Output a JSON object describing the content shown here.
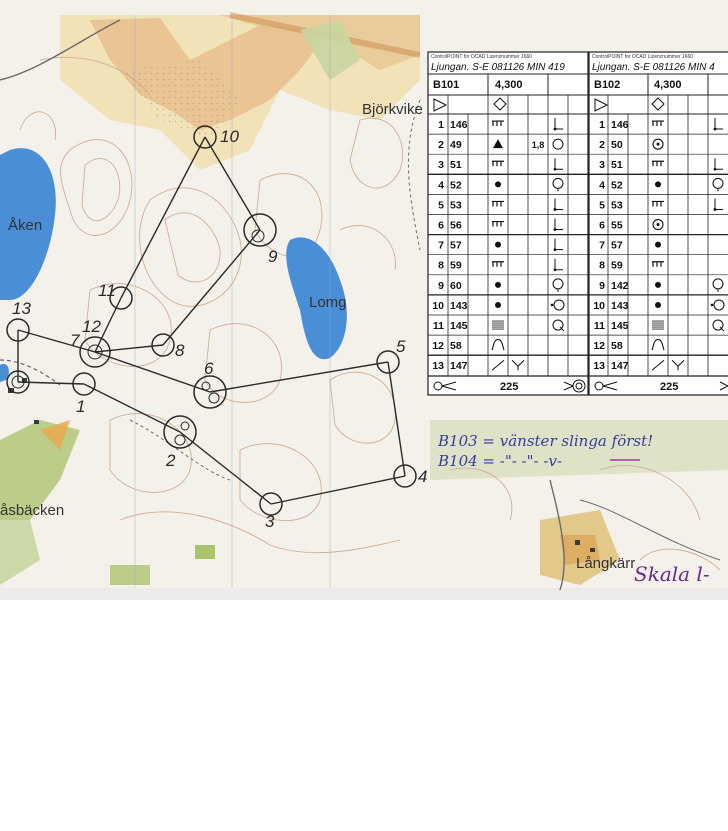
{
  "map": {
    "place_names": [
      "Björkvike",
      "Åken",
      "Lomg",
      "åsbäcken",
      "Långkärr",
      "Skala l-"
    ],
    "controls": [
      "1",
      "2",
      "3",
      "4",
      "5",
      "6",
      "7",
      "8",
      "9",
      "10",
      "11",
      "12",
      "13"
    ],
    "handwritten_note_line1": "B103 = vänster slinga först!",
    "handwritten_note_line2": "B104 = -\"- -\"- -v-"
  },
  "card1": {
    "header_small": "ControlPOINT for OCAD Lizenznummer 1660",
    "title": "Ljungan. S-E 081126 MIN 419",
    "course": "B101",
    "length": "4,300",
    "rows": [
      {
        "n": "1",
        "code": "146",
        "sym": "cliff",
        "extra": "",
        "pos": "corner"
      },
      {
        "n": "2",
        "code": "49",
        "sym": "triangle",
        "extra": "1,8",
        "pos": "circle"
      },
      {
        "n": "3",
        "code": "51",
        "sym": "cliff",
        "extra": "",
        "pos": "corner"
      },
      {
        "n": "4",
        "code": "52",
        "sym": "dot",
        "extra": "",
        "pos": "circle-bottom"
      },
      {
        "n": "5",
        "code": "53",
        "sym": "cliff",
        "extra": "",
        "pos": "corner"
      },
      {
        "n": "6",
        "code": "56",
        "sym": "cliff",
        "extra": "",
        "pos": "corner"
      },
      {
        "n": "7",
        "code": "57",
        "sym": "dot",
        "extra": "",
        "pos": "corner"
      },
      {
        "n": "8",
        "code": "59",
        "sym": "cliff",
        "extra": "",
        "pos": "corner"
      },
      {
        "n": "9",
        "code": "60",
        "sym": "dot",
        "extra": "",
        "pos": "circle-bottom"
      },
      {
        "n": "10",
        "code": "143",
        "sym": "dot",
        "extra": "",
        "pos": "circle-left"
      },
      {
        "n": "11",
        "code": "145",
        "sym": "lines",
        "extra": "",
        "pos": "q"
      },
      {
        "n": "12",
        "code": "58",
        "sym": "arch",
        "extra": "",
        "pos": ""
      },
      {
        "n": "13",
        "code": "147",
        "sym": "vee",
        "extra": "",
        "pos": ""
      }
    ],
    "finish": "225"
  },
  "card2": {
    "header_small": "ControlPOINT for OCAD Lizenznummer 1660",
    "title": "Ljungan. S-E 081126 MIN 4",
    "course": "B102",
    "length": "4,300",
    "rows": [
      {
        "n": "1",
        "code": "146",
        "sym": "cliff",
        "pos": "corner"
      },
      {
        "n": "2",
        "code": "50",
        "sym": "ring",
        "pos": ""
      },
      {
        "n": "3",
        "code": "51",
        "sym": "cliff",
        "pos": "corner"
      },
      {
        "n": "4",
        "code": "52",
        "sym": "dot",
        "pos": "circle-bottom"
      },
      {
        "n": "5",
        "code": "53",
        "sym": "cliff",
        "pos": "corner"
      },
      {
        "n": "6",
        "code": "55",
        "sym": "ring",
        "pos": ""
      },
      {
        "n": "7",
        "code": "57",
        "sym": "dot",
        "pos": ""
      },
      {
        "n": "8",
        "code": "59",
        "sym": "cliff",
        "pos": ""
      },
      {
        "n": "9",
        "code": "142",
        "sym": "dot",
        "pos": "circle-bottom"
      },
      {
        "n": "10",
        "code": "143",
        "sym": "dot",
        "pos": "circle-left"
      },
      {
        "n": "11",
        "code": "145",
        "sym": "lines",
        "pos": "q"
      },
      {
        "n": "12",
        "code": "58",
        "sym": "arch",
        "pos": ""
      },
      {
        "n": "13",
        "code": "147",
        "sym": "vee",
        "pos": ""
      }
    ],
    "finish": "225"
  },
  "colors": {
    "paper": "#f3f1ea",
    "open_land": "#f2e6c4",
    "rough": "#e9b886",
    "forest_green": "#b9c98a",
    "green_dark": "#8aae4a",
    "water": "#4a8fd6",
    "contour": "#c9a489",
    "course": "#2a2a2a",
    "hand_blue": "#3a3a9a",
    "hand_purple": "#9a3a9a"
  }
}
